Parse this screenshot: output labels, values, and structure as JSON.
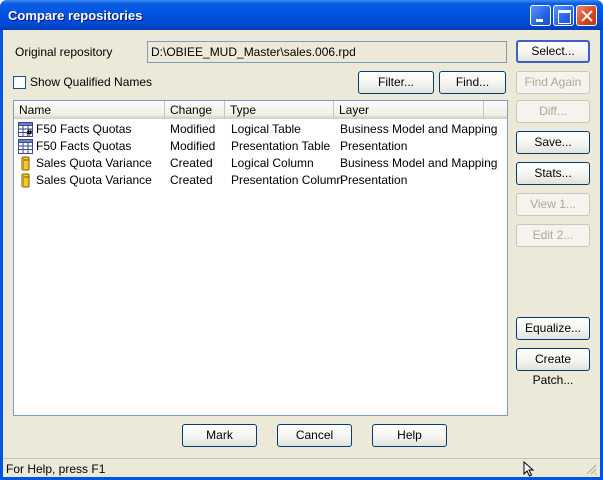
{
  "window": {
    "title": "Compare repositories"
  },
  "original_repo": {
    "label": "Original repository",
    "value": "D:\\OBIEE_MUD_Master\\sales.006.rpd"
  },
  "qualified_names": {
    "label": "Show Qualified Names",
    "checked": false
  },
  "buttons": {
    "select": "Select...",
    "filter": "Filter...",
    "find": "Find...",
    "find_again": "Find Again",
    "diff": "Diff...",
    "save": "Save...",
    "stats": "Stats...",
    "view": "View 1...",
    "edit": "Edit 2...",
    "equalize": "Equalize...",
    "create_patch": "Create Patch...",
    "mark": "Mark",
    "cancel": "Cancel",
    "help": "Help"
  },
  "list": {
    "columns": [
      "Name",
      "Change",
      "Type",
      "Layer"
    ],
    "rows": [
      {
        "icon": "table-icon",
        "name": "F50 Facts Quotas",
        "change": "Modified",
        "type": "Logical Table",
        "layer": "Business Model and Mapping"
      },
      {
        "icon": "table-icon",
        "name": "F50 Facts Quotas",
        "change": "Modified",
        "type": "Presentation Table",
        "layer": "Presentation"
      },
      {
        "icon": "column-icon",
        "name": "Sales Quota Variance",
        "change": "Created",
        "type": "Logical Column",
        "layer": "Business Model and Mapping"
      },
      {
        "icon": "column-icon",
        "name": "Sales Quota Variance",
        "change": "Created",
        "type": "Presentation Column",
        "layer": "Presentation"
      }
    ]
  },
  "statusbar": {
    "text": "For Help, press F1"
  }
}
